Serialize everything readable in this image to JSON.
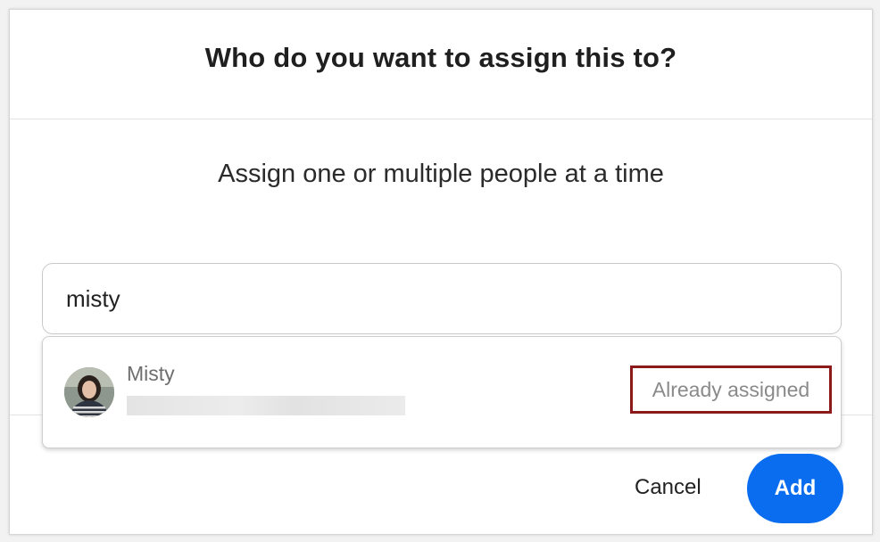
{
  "dialog": {
    "title": "Who do you want to assign this to?",
    "subtitle": "Assign one or multiple people at a time"
  },
  "search": {
    "value": "misty",
    "placeholder": ""
  },
  "results": [
    {
      "name": "Misty",
      "status": "Already assigned",
      "avatar_icon": "user-photo"
    }
  ],
  "footer": {
    "cancel_label": "Cancel",
    "add_label": "Add"
  },
  "colors": {
    "primary": "#0a6df0",
    "highlight_border": "#8b1a1a"
  }
}
